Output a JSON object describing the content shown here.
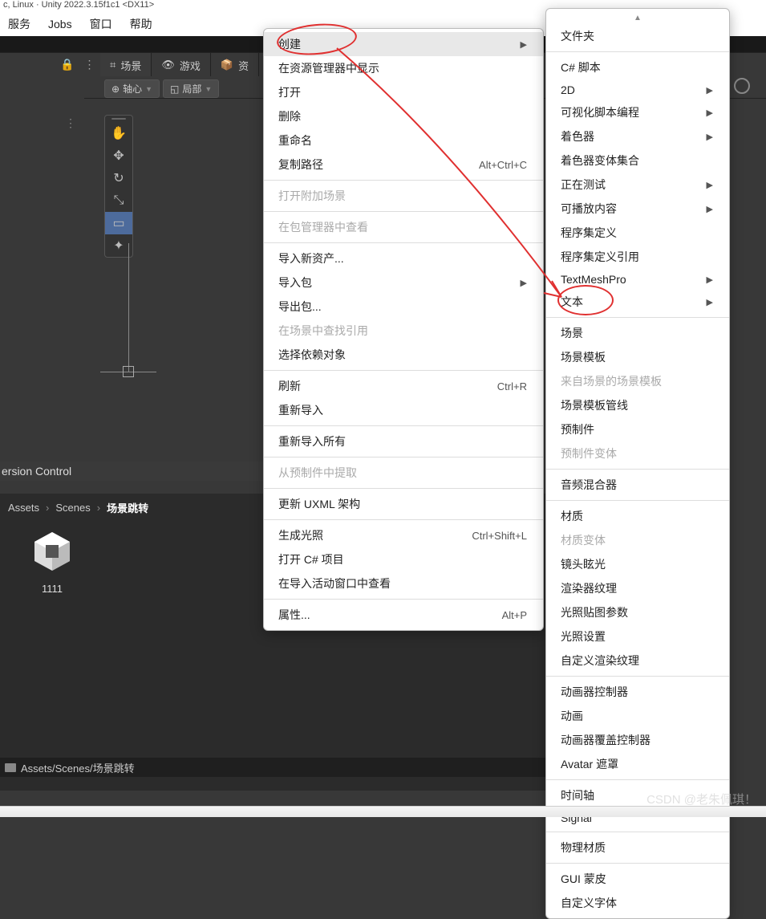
{
  "title_fragment": "c, Linux · Unity 2022.3.15f1c1 <DX11>",
  "menubar": [
    "服务",
    "Jobs",
    "窗口",
    "帮助"
  ],
  "tabs": {
    "scene": "场景",
    "game": "游戏",
    "asset_prefix": "资"
  },
  "pivot": {
    "center": "轴心",
    "local": "局部"
  },
  "version_control": "ersion Control",
  "breadcrumb": {
    "a": "Assets",
    "b": "Scenes",
    "c": "场景跳转"
  },
  "asset": {
    "name": "1111"
  },
  "status_path": "Assets/Scenes/场景跳转",
  "watermark": "CSDN @老朱佩琪！",
  "context_menu": [
    {
      "label": "创建",
      "submenu": true,
      "highlight": true
    },
    {
      "label": "在资源管理器中显示"
    },
    {
      "label": "打开"
    },
    {
      "label": "删除"
    },
    {
      "label": "重命名"
    },
    {
      "label": "复制路径",
      "shortcut": "Alt+Ctrl+C"
    },
    {
      "sep": true
    },
    {
      "label": "打开附加场景",
      "disabled": true
    },
    {
      "sep": true
    },
    {
      "label": "在包管理器中查看",
      "disabled": true
    },
    {
      "sep": true
    },
    {
      "label": "导入新资产..."
    },
    {
      "label": "导入包",
      "submenu": true
    },
    {
      "label": "导出包..."
    },
    {
      "label": "在场景中查找引用",
      "disabled": true
    },
    {
      "label": "选择依赖对象"
    },
    {
      "sep": true
    },
    {
      "label": "刷新",
      "shortcut": "Ctrl+R"
    },
    {
      "label": "重新导入"
    },
    {
      "sep": true
    },
    {
      "label": "重新导入所有"
    },
    {
      "sep": true
    },
    {
      "label": "从预制件中提取",
      "disabled": true
    },
    {
      "sep": true
    },
    {
      "label": "更新 UXML 架构"
    },
    {
      "sep": true
    },
    {
      "label": "生成光照",
      "shortcut": "Ctrl+Shift+L"
    },
    {
      "label": "打开 C# 项目"
    },
    {
      "label": "在导入活动窗口中查看"
    },
    {
      "sep": true
    },
    {
      "label": "属性...",
      "shortcut": "Alt+P"
    }
  ],
  "submenu": [
    {
      "label": "文件夹"
    },
    {
      "sep": true
    },
    {
      "label": "C# 脚本"
    },
    {
      "label": "2D",
      "submenu": true
    },
    {
      "label": "可视化脚本编程",
      "submenu": true
    },
    {
      "label": "着色器",
      "submenu": true
    },
    {
      "label": "着色器变体集合"
    },
    {
      "label": "正在测试",
      "submenu": true
    },
    {
      "label": "可播放内容",
      "submenu": true
    },
    {
      "label": "程序集定义"
    },
    {
      "label": "程序集定义引用"
    },
    {
      "label": "TextMeshPro",
      "submenu": true
    },
    {
      "label": "文本",
      "submenu": true
    },
    {
      "sep": true
    },
    {
      "label": "场景"
    },
    {
      "label": "场景模板"
    },
    {
      "label": "来自场景的场景模板",
      "disabled": true
    },
    {
      "label": "场景模板管线"
    },
    {
      "label": "预制件"
    },
    {
      "label": "预制件变体",
      "disabled": true
    },
    {
      "sep": true
    },
    {
      "label": "音频混合器"
    },
    {
      "sep": true
    },
    {
      "label": "材质"
    },
    {
      "label": "材质变体",
      "disabled": true
    },
    {
      "label": "镜头眩光"
    },
    {
      "label": "渲染器纹理"
    },
    {
      "label": "光照贴图参数"
    },
    {
      "label": "光照设置"
    },
    {
      "label": "自定义渲染纹理"
    },
    {
      "sep": true
    },
    {
      "label": "动画器控制器"
    },
    {
      "label": "动画"
    },
    {
      "label": "动画器覆盖控制器"
    },
    {
      "label": "Avatar 遮罩"
    },
    {
      "sep": true
    },
    {
      "label": "时间轴"
    },
    {
      "label": "Signal"
    },
    {
      "sep": true
    },
    {
      "label": "物理材质"
    },
    {
      "sep": true
    },
    {
      "label": "GUI 蒙皮"
    },
    {
      "label": "自定义字体"
    }
  ]
}
